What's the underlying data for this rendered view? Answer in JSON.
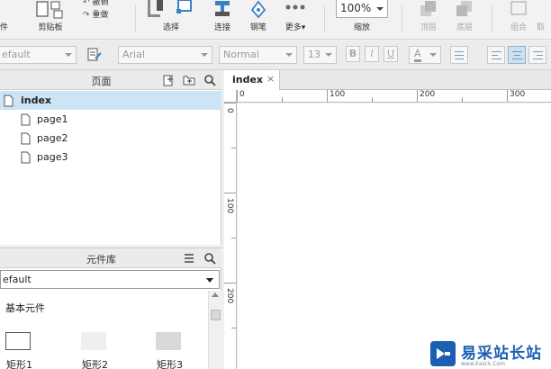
{
  "toolbar": {
    "file_label": "件",
    "clipboard_label": "剪贴板",
    "undo_label": "撤销",
    "redo_label": "重做",
    "select_label": "选择",
    "connect_label": "连接",
    "pen_label": "钢笔",
    "more_label": "更多▾",
    "zoom_value": "100%",
    "zoom_label": "缩放",
    "top_label": "顶层",
    "bottom_label": "底层",
    "group_label": "组合",
    "ungroup_label": "取"
  },
  "format_bar": {
    "style_value": "efault",
    "font_value": "Arial",
    "weight_value": "Normal",
    "size_value": "13",
    "bold": "B",
    "italic": "I",
    "underline": "U",
    "font_color": "A"
  },
  "pages_panel": {
    "title": "页面",
    "pages": [
      {
        "name": "index",
        "selected": true
      },
      {
        "name": "page1",
        "selected": false
      },
      {
        "name": "page2",
        "selected": false
      },
      {
        "name": "page3",
        "selected": false
      }
    ]
  },
  "library_panel": {
    "title": "元件库",
    "selected_library": "efault",
    "section_label": "基本元件",
    "widgets": [
      {
        "label": "矩形1"
      },
      {
        "label": "矩形2"
      },
      {
        "label": "矩形3"
      }
    ]
  },
  "canvas": {
    "tab_label": "index",
    "tab_close": "×",
    "ruler_h_labels": [
      "0",
      "100",
      "200",
      "300"
    ],
    "ruler_v_labels": [
      "0",
      "100",
      "200"
    ]
  },
  "watermark": {
    "name": "易采站长站",
    "url": "www.Easck.Com"
  },
  "colors": {
    "selection": "#cde4f5",
    "accent": "#1b5fb4",
    "tool_blue": "#3b7fc4"
  }
}
